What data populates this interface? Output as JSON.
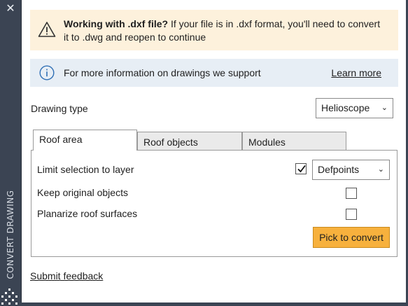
{
  "sidebar": {
    "close_label": "✕",
    "title": "CONVERT DRAWING"
  },
  "warning": {
    "title": "Working with .dxf file?",
    "message": " If your file is in .dxf format, you'll need to convert it to .dwg and reopen to continue",
    "icon": "warning-icon"
  },
  "info": {
    "message": "For more information on drawings we support",
    "link_label": "Learn more",
    "icon": "info-icon"
  },
  "drawing_type": {
    "label": "Drawing type",
    "selected": "Helioscope"
  },
  "tabs": [
    {
      "label": "Roof area",
      "active": true
    },
    {
      "label": "Roof objects",
      "active": false
    },
    {
      "label": "Modules",
      "active": false
    }
  ],
  "roof_area": {
    "limit_label": "Limit selection to layer",
    "limit_checked": true,
    "layer_selected": "Defpoints",
    "keep_label": "Keep original objects",
    "keep_checked": false,
    "planarize_label": "Planarize roof surfaces",
    "planarize_checked": false,
    "pick_button": "Pick to convert"
  },
  "footer": {
    "feedback_label": "Submit feedback"
  },
  "colors": {
    "sidebar": "#3b4453",
    "warning_bg": "#fdf1dc",
    "info_bg": "#e7eef5",
    "accent_button": "#f7b13d"
  }
}
